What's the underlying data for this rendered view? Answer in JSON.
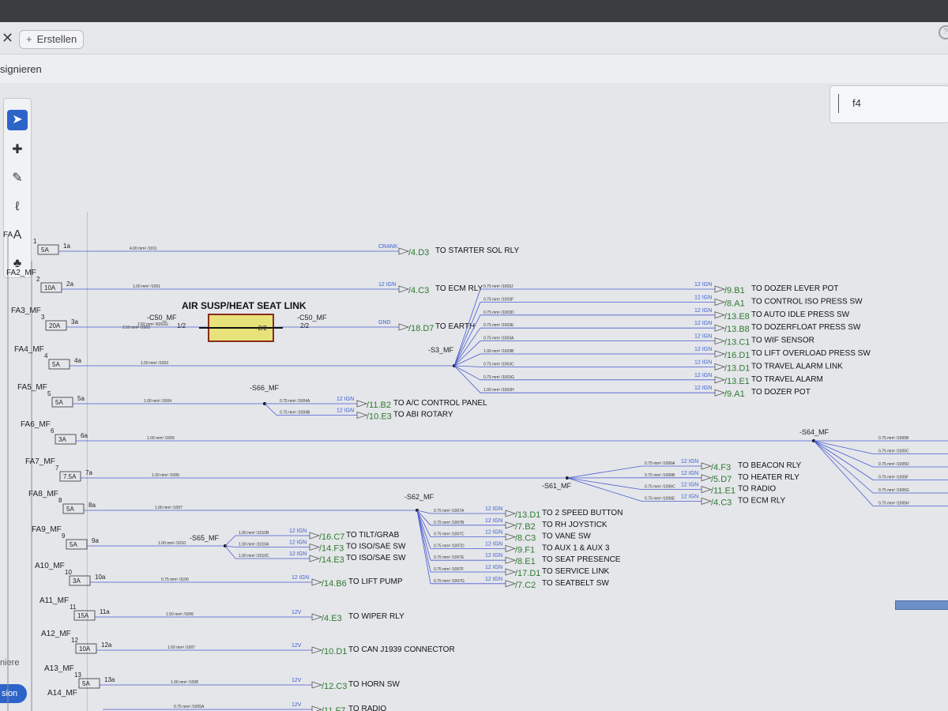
{
  "tab": {
    "close_icon": "close-icon",
    "create_label": "Erstellen"
  },
  "menu": {
    "label": "signieren"
  },
  "search": {
    "value": "f4"
  },
  "toolbar": {
    "tools": [
      "pointer-icon",
      "comment-icon",
      "pen-icon",
      "lasso-icon",
      "text-box-icon",
      "stamp-icon"
    ]
  },
  "left_panel": {
    "label": "niere",
    "button": "sion"
  },
  "schematic": {
    "title": "AIR SUSP/HEAT SEAT LINK",
    "fuses": [
      {
        "name": "FA",
        "num": "1",
        "rating": "5A",
        "out": "1a"
      },
      {
        "name": "FA2_MF",
        "num": "2",
        "rating": "10A",
        "out": "2a"
      },
      {
        "name": "FA3_MF",
        "num": "3",
        "rating": "20A",
        "out": "3a"
      },
      {
        "name": "FA4_MF",
        "num": "4",
        "rating": "5A",
        "out": "4a"
      },
      {
        "name": "FA5_MF",
        "num": "5",
        "rating": "5A",
        "out": "5a"
      },
      {
        "name": "FA6_MF",
        "num": "6",
        "rating": "3A",
        "out": "6a"
      },
      {
        "name": "FA7_MF",
        "num": "7",
        "rating": "7.5A",
        "out": "7a"
      },
      {
        "name": "FA8_MF",
        "num": "8",
        "rating": "5A",
        "out": "8a"
      },
      {
        "name": "FA9_MF",
        "num": "9",
        "rating": "5A",
        "out": "9a"
      },
      {
        "name": "A10_MF",
        "num": "10",
        "rating": "3A",
        "out": "10a"
      },
      {
        "name": "A11_MF",
        "num": "11",
        "rating": "15A",
        "out": "11a"
      },
      {
        "name": "A12_MF",
        "num": "12",
        "rating": "10A",
        "out": "12a"
      },
      {
        "name": "A13_MF",
        "num": "13",
        "rating": "5A",
        "out": "13a"
      },
      {
        "name": "A14_MF",
        "num": "14",
        "rating": "",
        "out": ""
      }
    ],
    "main_wires": [
      {
        "wire": "4.00 mm² /1011",
        "sig": "CRANK",
        "ref": "/4.D3",
        "dest": "TO STARTER SOL RLY"
      },
      {
        "wire": "1.00 mm² /1001",
        "sig": "12 IGN",
        "ref": "/4.C3",
        "dest": "TO ECM RLY"
      },
      {
        "wire": "2.50 mm² /6002G",
        "sig": "GND",
        "ref": "/18.D7",
        "dest": "TO EARTH"
      },
      {
        "wire": "1.00 mm² /1003",
        "sig": "",
        "ref": "",
        "dest": ""
      },
      {
        "wire": "1.00 mm² /1004",
        "sig": "",
        "ref": "",
        "dest": ""
      },
      {
        "wire": "1.00 mm² /1005",
        "sig": "",
        "ref": "",
        "dest": ""
      },
      {
        "wire": "1.00 mm² /1006",
        "sig": "",
        "ref": "",
        "dest": ""
      },
      {
        "wire": "1.00 mm² /1007",
        "sig": "",
        "ref": "",
        "dest": ""
      },
      {
        "wire": "1.00 mm² /1010",
        "sig": "",
        "ref": "",
        "dest": ""
      },
      {
        "wire": "0.75 mm² /1100",
        "sig": "12 IGN",
        "ref": "/14.B6",
        "dest": "TO LIFT PUMP"
      },
      {
        "wire": "1.50 mm² /1006",
        "sig": "12V",
        "ref": "/4.E3",
        "dest": "TO WIPER RLY"
      },
      {
        "wire": "1.00 mm² /1007",
        "sig": "12V",
        "ref": "/10.D1",
        "dest": "TO CAN J1939 CONNECTOR"
      },
      {
        "wire": "1.00 mm² /1008",
        "sig": "12V",
        "ref": "/12.C3",
        "dest": "TO HORN SW"
      },
      {
        "wire": "0.75 mm² /1005A",
        "sig": "12V",
        "ref": "/11.F7",
        "dest": "TO RADIO"
      }
    ],
    "connector_c50": {
      "left_label": "-C50_MF",
      "right_label": "-C50_MF",
      "pin_left": "1/2",
      "pin_right": "2/2",
      "wire_left": "2.50 mm² /1002",
      "core": "-2/2"
    },
    "s3": {
      "label": "-S3_MF",
      "branches": [
        {
          "wire": "0.75 mm² /1003J",
          "sig": "12 IGN",
          "ref": "/9.B1",
          "dest": "TO DOZER LEVER POT"
        },
        {
          "wire": "0.75 mm² /1003F",
          "sig": "12 IGN",
          "ref": "/8.A1",
          "dest": "TO CONTROL ISO PRESS SW"
        },
        {
          "wire": "0.75 mm² /1003D",
          "sig": "12 IGN",
          "ref": "/13.E8",
          "dest": "TO AUTO IDLE PRESS SW"
        },
        {
          "wire": "0.75 mm² /1003E",
          "sig": "12 IGN",
          "ref": "/13.B8",
          "dest": "TO DOZERFLOAT PRESS SW"
        },
        {
          "wire": "0.75 mm² /1003A",
          "sig": "12 IGN",
          "ref": "/13.C1",
          "dest": "TO WIF SENSOR"
        },
        {
          "wire": "1.00 mm² /1003B",
          "sig": "12 IGN",
          "ref": "/16.D1",
          "dest": "TO LIFT OVERLOAD PRESS SW"
        },
        {
          "wire": "0.75 mm² /1003C",
          "sig": "12 IGN",
          "ref": "/13.D1",
          "dest": "TO TRAVEL ALARM LINK"
        },
        {
          "wire": "0.75 mm² /1003G",
          "sig": "12 IGN",
          "ref": "/13.E1",
          "dest": "TO TRAVEL ALARM"
        },
        {
          "wire": "1.00 mm² /1003H",
          "sig": "12 IGN",
          "ref": "/9.A1",
          "dest": "TO DOZER POT"
        }
      ]
    },
    "s66": {
      "label": "-S66_MF",
      "branches": [
        {
          "wire": "0.75 mm² /1004A",
          "sig": "12 IGN",
          "ref": "/11.B2",
          "dest": "TO A/C CONTROL PANEL"
        },
        {
          "wire": "0.75 mm² /1004B",
          "sig": "12 IGN",
          "ref": "/10.E3",
          "dest": "TO ABI ROTARY"
        }
      ]
    },
    "s64": {
      "label": "-S64_MF",
      "branches": [
        {
          "wire": "0.75 mm² /1005B"
        },
        {
          "wire": "0.75 mm² /1005C"
        },
        {
          "wire": "0.75 mm² /1005D"
        },
        {
          "wire": "0.75 mm² /1005F"
        },
        {
          "wire": "0.75 mm² /1005G"
        },
        {
          "wire": "0.75 mm² /1005H"
        }
      ]
    },
    "s61": {
      "label": "-S61_MF",
      "branches": [
        {
          "wire": "0.75 mm² /1006A",
          "sig": "12 IGN",
          "ref": "/4.F3",
          "dest": "TO BEACON RLY"
        },
        {
          "wire": "0.75 mm² /1006B",
          "sig": "12 IGN",
          "ref": "/5.D7",
          "dest": "TO HEATER RLY"
        },
        {
          "wire": "0.75 mm² /1006C",
          "sig": "12 IGN",
          "ref": "/11.E1",
          "dest": "TO RADIO"
        },
        {
          "wire": "0.75 mm² /1006E",
          "sig": "12 IGN",
          "ref": "/4.C3",
          "dest": "TO ECM RLY"
        }
      ]
    },
    "s62": {
      "label": "-S62_MF",
      "branches": [
        {
          "wire": "0.75 mm² /1007A",
          "sig": "12 IGN",
          "ref": "/13.D1",
          "dest": "TO 2 SPEED BUTTON"
        },
        {
          "wire": "0.75 mm² /1007B",
          "sig": "12 IGN",
          "ref": "/7.B2",
          "dest": "TO RH JOYSTICK"
        },
        {
          "wire": "0.75 mm² /1007C",
          "sig": "12 IGN",
          "ref": "/8.C3",
          "dest": "TO VANE SW"
        },
        {
          "wire": "0.75 mm² /1007D",
          "sig": "12 IGN",
          "ref": "/9.F1",
          "dest": "TO AUX 1 & AUX 3"
        },
        {
          "wire": "0.75 mm² /1007E",
          "sig": "12 IGN",
          "ref": "/8.E1",
          "dest": "TO SEAT PRESENCE"
        },
        {
          "wire": "0.75 mm² /1007F",
          "sig": "12 IGN",
          "ref": "/17.D1",
          "dest": "TO SERVICE LINK"
        },
        {
          "wire": "0.75 mm² /1007G",
          "sig": "12 IGN",
          "ref": "/7.C2",
          "dest": "TO SEATBELT SW"
        }
      ]
    },
    "s65": {
      "label": "-S65_MF",
      "branches": [
        {
          "wire": "1.00 mm² /1010B",
          "sig": "12 IGN",
          "ref": "/16.C7",
          "dest": "TO TILT/GRAB"
        },
        {
          "wire": "1.00 mm² /1010A",
          "sig": "12 IGN",
          "ref": "/14.F3",
          "dest": "TO ISO/SAE SW"
        },
        {
          "wire": "1.00 mm² /1010C",
          "sig": "12 IGN",
          "ref": "/14.E3",
          "dest": "TO ISO/SAE SW"
        }
      ]
    }
  }
}
